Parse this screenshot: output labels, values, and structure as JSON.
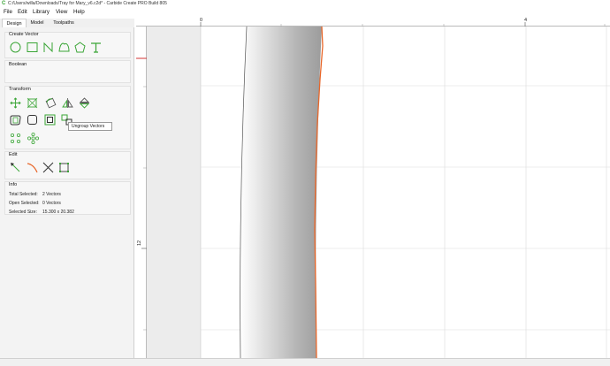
{
  "window": {
    "title": "C:/Users/willa/Downloads/Tray for Mary_v6.c2d* - Carbide Create PRO Build 805",
    "app_icon": "carbide-create-icon"
  },
  "menu": [
    "File",
    "Edit",
    "Library",
    "View",
    "Help"
  ],
  "tabs": [
    "Design",
    "Model",
    "Toolpaths"
  ],
  "active_tab": "Design",
  "sections": {
    "create_vector": "Create Vector",
    "boolean": "Boolean",
    "transform": "Transform",
    "edit": "Edit",
    "info": "Info"
  },
  "create_vector_tools": [
    "circle-icon",
    "rectangle-icon",
    "polyline-icon",
    "curve-icon",
    "polygon-icon",
    "text-icon"
  ],
  "transform_tools": [
    "move-icon",
    "align-icon",
    "rotate-icon",
    "mirror-icon",
    "flip-icon",
    "offset-icon",
    "fillet-icon",
    "group-icon",
    "ungroup-icon",
    "circular-array-icon",
    "rectangular-array-icon"
  ],
  "edit_tools": [
    "node-edit-icon",
    "knife-icon",
    "trim-icon",
    "bounding-box-icon"
  ],
  "tooltip": "Ungroup Vectors",
  "info": {
    "total_selected_label": "Total Selected:",
    "total_selected_value": "2 Vectors",
    "open_selected_label": "Open Selected:",
    "open_selected_value": "0 Vectors",
    "selected_size_label": "Selected Size:",
    "selected_size_value": "15.300 x 20.382"
  },
  "ruler": {
    "top_labels": [
      "0",
      "4"
    ],
    "left_label": "12"
  },
  "colors": {
    "accent_green": "#3aa536",
    "selection_orange": "#e8672a",
    "ruler_marker": "#d33333"
  }
}
